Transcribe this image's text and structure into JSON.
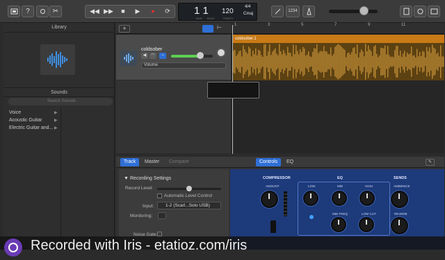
{
  "toolbar": {
    "tempo": "120",
    "bar_beat": "1  1",
    "time_signature": "4/4",
    "key": "Cmaj",
    "count_in": "1234",
    "lcd_labels": {
      "bar": "BAR",
      "beat": "BEAT",
      "tempo": "TEMPO"
    }
  },
  "library": {
    "title": "Library",
    "sounds_title": "Sounds",
    "search_placeholder": "Search Sounds",
    "categories": [
      "Voice",
      "Acoustic Guitar",
      "Electric Guitar and..."
    ]
  },
  "tracks": {
    "add_label": "+",
    "track_name": "coldsober",
    "automation": "Volume",
    "region_name": "coldsober.1",
    "ruler": [
      "1",
      "3",
      "5",
      "7",
      "9",
      "11"
    ],
    "track_volume": 0.75
  },
  "editor": {
    "tabs": [
      "Track",
      "Master",
      "Compare"
    ],
    "plugin_tabs": [
      "Controls",
      "EQ"
    ],
    "recording_settings": "Recording Settings",
    "record_level": "Record Level:",
    "auto_level": "Automatic Level Control",
    "input_label": "Input:",
    "input_value": "1-2  (Scarl...Solo USB)",
    "monitoring": "Monitoring:",
    "noise_gate": "Noise Gate:"
  },
  "plugin": {
    "compressor": "COMPRESSOR",
    "eq": "EQ",
    "sends": "SENDS",
    "knobs": [
      "AMOUNT",
      "LOW",
      "MID",
      "HIGH",
      "AMBIENCE",
      "MID FREQ",
      "LOW CUT",
      "REVERB"
    ]
  },
  "overlay": {
    "text": "Recorded with Iris - etatioz.com/iris"
  }
}
